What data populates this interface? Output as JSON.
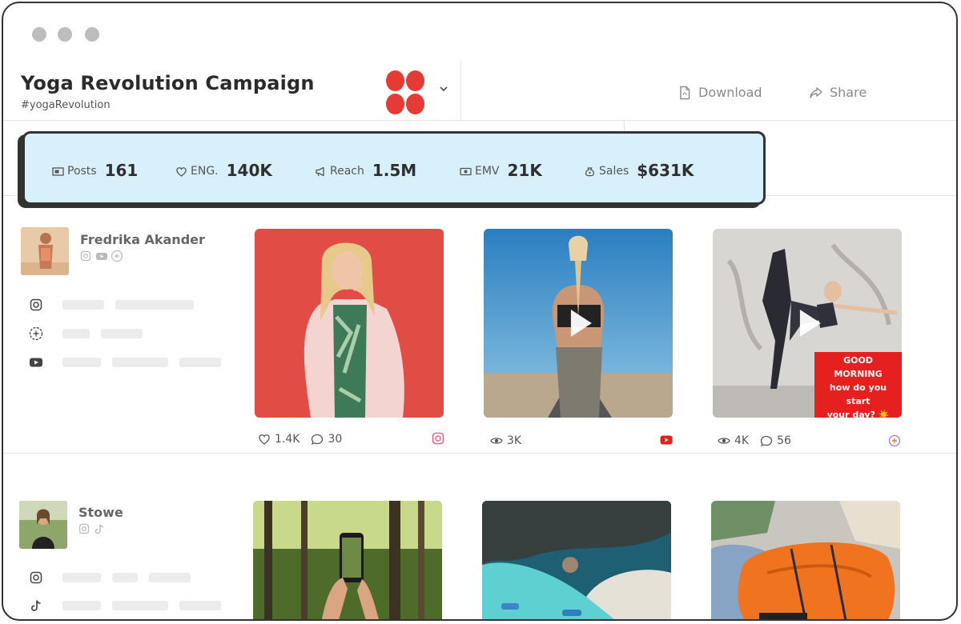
{
  "campaign": {
    "title": "Yoga Revolution Campaign",
    "hashtag": "#yogaRevolution",
    "brand_color": "#e53b34"
  },
  "actions": {
    "download_label": "Download",
    "share_label": "Share"
  },
  "stats": [
    {
      "label": "Posts",
      "value": "161",
      "icon": "posts-icon"
    },
    {
      "label": "ENG.",
      "value": "140K",
      "icon": "heart-icon"
    },
    {
      "label": "Reach",
      "value": "1.5M",
      "icon": "megaphone-icon"
    },
    {
      "label": "EMV",
      "value": "21K",
      "icon": "money-icon"
    },
    {
      "label": "Sales",
      "value": "$631K",
      "icon": "money-bag-icon"
    }
  ],
  "influencers": [
    {
      "name": "Fredrika Akander",
      "platforms": [
        "instagram-icon",
        "youtube-icon",
        "snapchat-icon"
      ],
      "posts": [
        {
          "metric1": "1.4K",
          "metric1_icon": "heart-icon",
          "metric2": "30",
          "metric2_icon": "comment-icon",
          "platform": "instagram-icon",
          "video": false
        },
        {
          "metric1": "3K",
          "metric1_icon": "eye-icon",
          "platform": "youtube-icon",
          "video": true
        },
        {
          "metric1": "4K",
          "metric1_icon": "eye-icon",
          "metric2": "56",
          "metric2_icon": "comment-icon",
          "platform": "snapchat-icon",
          "video": true,
          "overlay": [
            "GOOD MORNING",
            "how do you start",
            "your day? ☀️"
          ]
        }
      ]
    },
    {
      "name": "Stowe",
      "platforms": [
        "instagram-icon",
        "tiktok-icon"
      ],
      "posts": [
        {
          "platform": "instagram-icon",
          "video": false
        },
        {
          "platform": "instagram-icon",
          "video": false
        },
        {
          "platform": "instagram-icon",
          "video": false
        }
      ]
    }
  ]
}
